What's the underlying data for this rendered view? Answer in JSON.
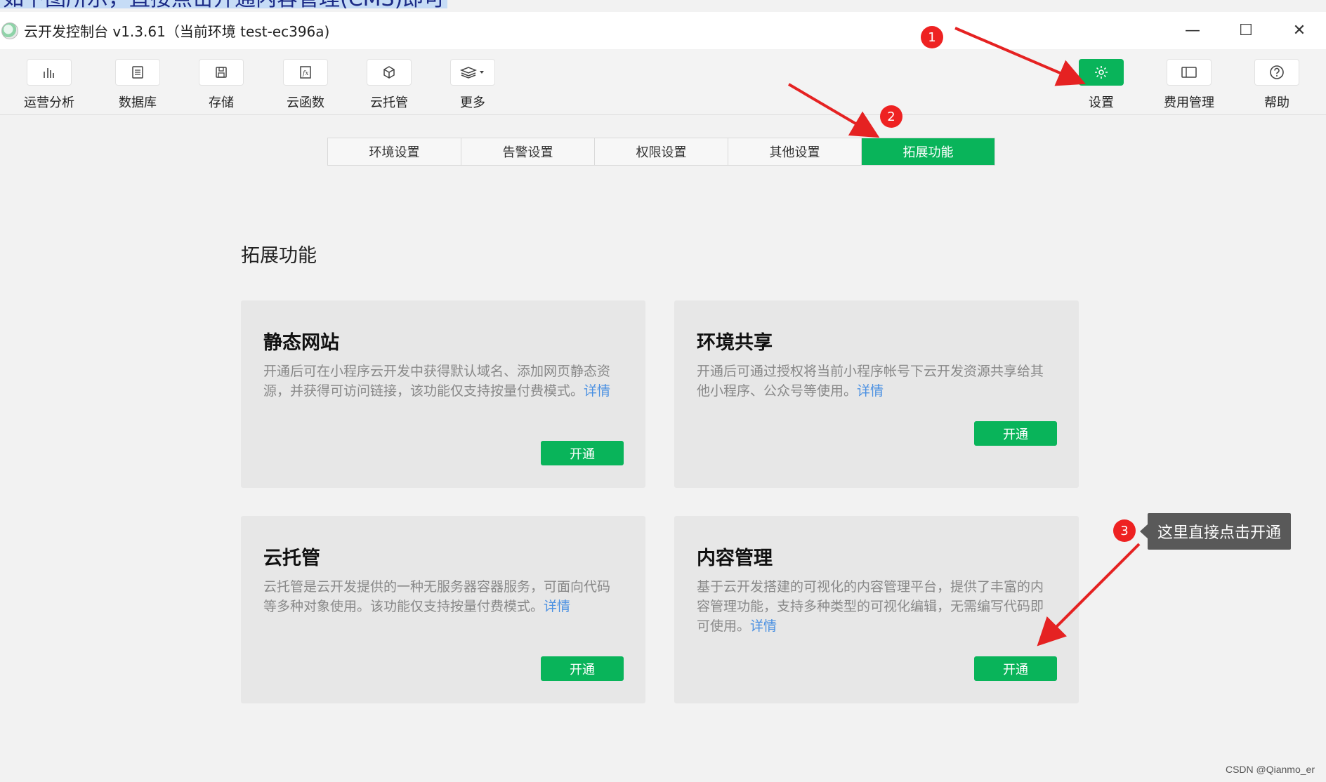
{
  "caption": "如下图所示，直接点击开通内容管理(CMS)即可",
  "window": {
    "title": "云开发控制台 v1.3.61（当前环境 test-ec396a)",
    "controls": [
      "—",
      "☐",
      "✕"
    ]
  },
  "toolbar": {
    "left": [
      {
        "label": "运营分析",
        "icon": "bar-chart-icon"
      },
      {
        "label": "数据库",
        "icon": "database-icon"
      },
      {
        "label": "存储",
        "icon": "storage-icon"
      },
      {
        "label": "云函数",
        "icon": "function-icon"
      },
      {
        "label": "云托管",
        "icon": "cube-icon"
      },
      {
        "label": "更多",
        "icon": "layers-icon"
      }
    ],
    "right": [
      {
        "label": "设置",
        "icon": "gear-icon",
        "active": true
      },
      {
        "label": "费用管理",
        "icon": "billing-icon"
      },
      {
        "label": "帮助",
        "icon": "help-icon"
      }
    ]
  },
  "tabs": [
    "环境设置",
    "告警设置",
    "权限设置",
    "其他设置",
    "拓展功能"
  ],
  "active_tab": "拓展功能",
  "section_title": "拓展功能",
  "cards": [
    {
      "title": "静态网站",
      "desc": "开通后可在小程序云开发中获得默认域名、添加网页静态资源，并获得可访问链接，该功能仅支持按量付费模式。",
      "link": "详情",
      "button": "开通"
    },
    {
      "title": "环境共享",
      "desc": "开通后可通过授权将当前小程序帐号下云开发资源共享给其他小程序、公众号等使用。",
      "link": "详情",
      "button": "开通"
    },
    {
      "title": "云托管",
      "desc": "云托管是云开发提供的一种无服务器容器服务，可面向代码等多种对象使用。该功能仅支持按量付费模式。",
      "link": "详情",
      "button": "开通"
    },
    {
      "title": "内容管理",
      "desc": "基于云开发搭建的可视化的内容管理平台，提供了丰富的内容管理功能，支持多种类型的可视化编辑，无需编写代码即可使用。",
      "link": "详情",
      "button": "开通"
    }
  ],
  "annotations": {
    "badges": [
      "1",
      "2",
      "3"
    ],
    "callout": "这里直接点击开通",
    "color": "#e52222"
  },
  "watermark": "CSDN @Qianmo_er",
  "colors": {
    "accent": "#09b45a",
    "link": "#4a90e2"
  }
}
